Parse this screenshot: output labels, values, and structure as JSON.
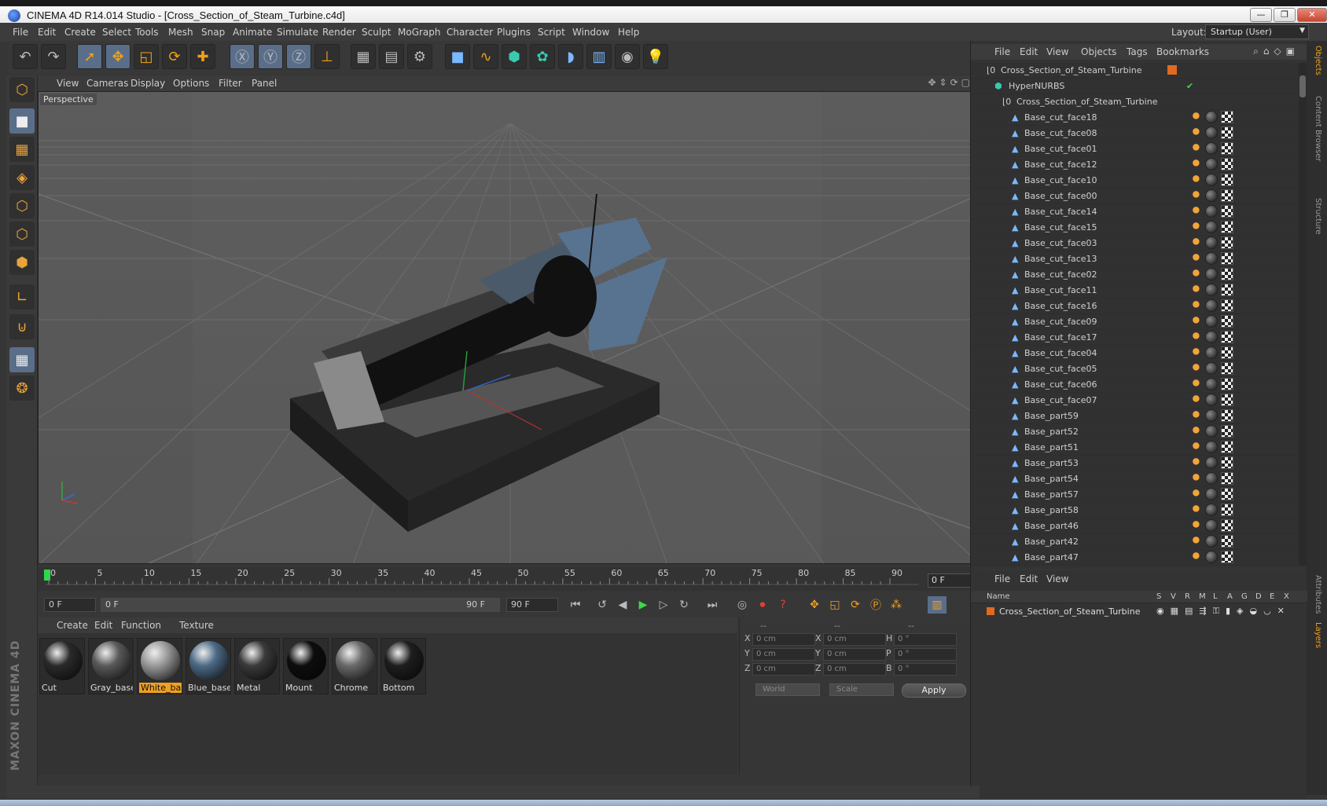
{
  "window": {
    "title": "CINEMA 4D R14.014 Studio - [Cross_Section_of_Steam_Turbine.c4d]",
    "min_label": "—",
    "max_label": "❐",
    "close_label": "✕"
  },
  "menubar": {
    "items": [
      "File",
      "Edit",
      "Create",
      "Select",
      "Tools",
      "Mesh",
      "Snap",
      "Animate",
      "Simulate",
      "Render",
      "Sculpt",
      "MoGraph",
      "Character",
      "Plugins",
      "Script",
      "Window",
      "Help"
    ],
    "layout_label": "Layout:",
    "layout_value": "Startup (User)"
  },
  "viewport": {
    "menu": [
      "View",
      "Cameras",
      "Display",
      "Options",
      "Filter",
      "Panel"
    ],
    "label": "Perspective"
  },
  "timeline": {
    "ticks": [
      "0",
      "5",
      "10",
      "15",
      "20",
      "25",
      "30",
      "35",
      "40",
      "45",
      "50",
      "55",
      "60",
      "65",
      "70",
      "75",
      "80",
      "85",
      "90"
    ],
    "current_frame": "0 F",
    "start_frame": "0 F",
    "range_start": "0 F",
    "range_end": "90 F",
    "end_frame": "90 F"
  },
  "material_manager": {
    "menu": [
      "Create",
      "Edit",
      "Function",
      "Texture"
    ],
    "materials": [
      {
        "name": "Cut",
        "color": "#2a2a2a"
      },
      {
        "name": "Gray_base",
        "color": "#5a5a5a"
      },
      {
        "name": "White_basi",
        "color": "#9a9a9a",
        "selected": true
      },
      {
        "name": "Blue_base",
        "color": "#4d6a86"
      },
      {
        "name": "Metal",
        "color": "#3a3a3a"
      },
      {
        "name": "Mount",
        "color": "#0d0d0d"
      },
      {
        "name": "Chrome",
        "color": "#6a6a6a"
      },
      {
        "name": "Bottom",
        "color": "#1e1e1e"
      }
    ]
  },
  "coordinates": {
    "headers": [
      "--",
      "--",
      "--"
    ],
    "rows": [
      {
        "a": "X",
        "v1": "0 cm",
        "b": "X",
        "v2": "0 cm",
        "c": "H",
        "v3": "0 °"
      },
      {
        "a": "Y",
        "v1": "0 cm",
        "b": "Y",
        "v2": "0 cm",
        "c": "P",
        "v3": "0 °"
      },
      {
        "a": "Z",
        "v1": "0 cm",
        "b": "Z",
        "v2": "0 cm",
        "c": "B",
        "v3": "0 °"
      }
    ],
    "mode1": "World",
    "mode2": "Scale",
    "apply": "Apply"
  },
  "object_manager": {
    "menu": [
      "File",
      "Edit",
      "View",
      "Objects",
      "Tags",
      "Bookmarks"
    ],
    "root": "Cross_Section_of_Steam_Turbine",
    "nurbs": "HyperNURBS",
    "group": "Cross_Section_of_Steam_Turbine",
    "items": [
      "Base_cut_face18",
      "Base_cut_face08",
      "Base_cut_face01",
      "Base_cut_face12",
      "Base_cut_face10",
      "Base_cut_face00",
      "Base_cut_face14",
      "Base_cut_face15",
      "Base_cut_face03",
      "Base_cut_face13",
      "Base_cut_face02",
      "Base_cut_face11",
      "Base_cut_face16",
      "Base_cut_face09",
      "Base_cut_face17",
      "Base_cut_face04",
      "Base_cut_face05",
      "Base_cut_face06",
      "Base_cut_face07",
      "Base_part59",
      "Base_part52",
      "Base_part51",
      "Base_part53",
      "Base_part54",
      "Base_part57",
      "Base_part58",
      "Base_part46",
      "Base_part42",
      "Base_part47"
    ]
  },
  "side_tabs": [
    "Objects",
    "Content Browser",
    "Structure"
  ],
  "side_tabs_bottom": [
    "Attributes",
    "Layers"
  ],
  "layer_manager": {
    "menu": [
      "File",
      "Edit",
      "View"
    ],
    "columns": [
      "Name",
      "S",
      "V",
      "R",
      "M",
      "L",
      "A",
      "G",
      "D",
      "E",
      "X"
    ],
    "layer_name": "Cross_Section_of_Steam_Turbine"
  },
  "branding": "MAXON CINEMA 4D",
  "colors": {
    "accent": "#f0a020",
    "selection": "#5a6e8a"
  }
}
